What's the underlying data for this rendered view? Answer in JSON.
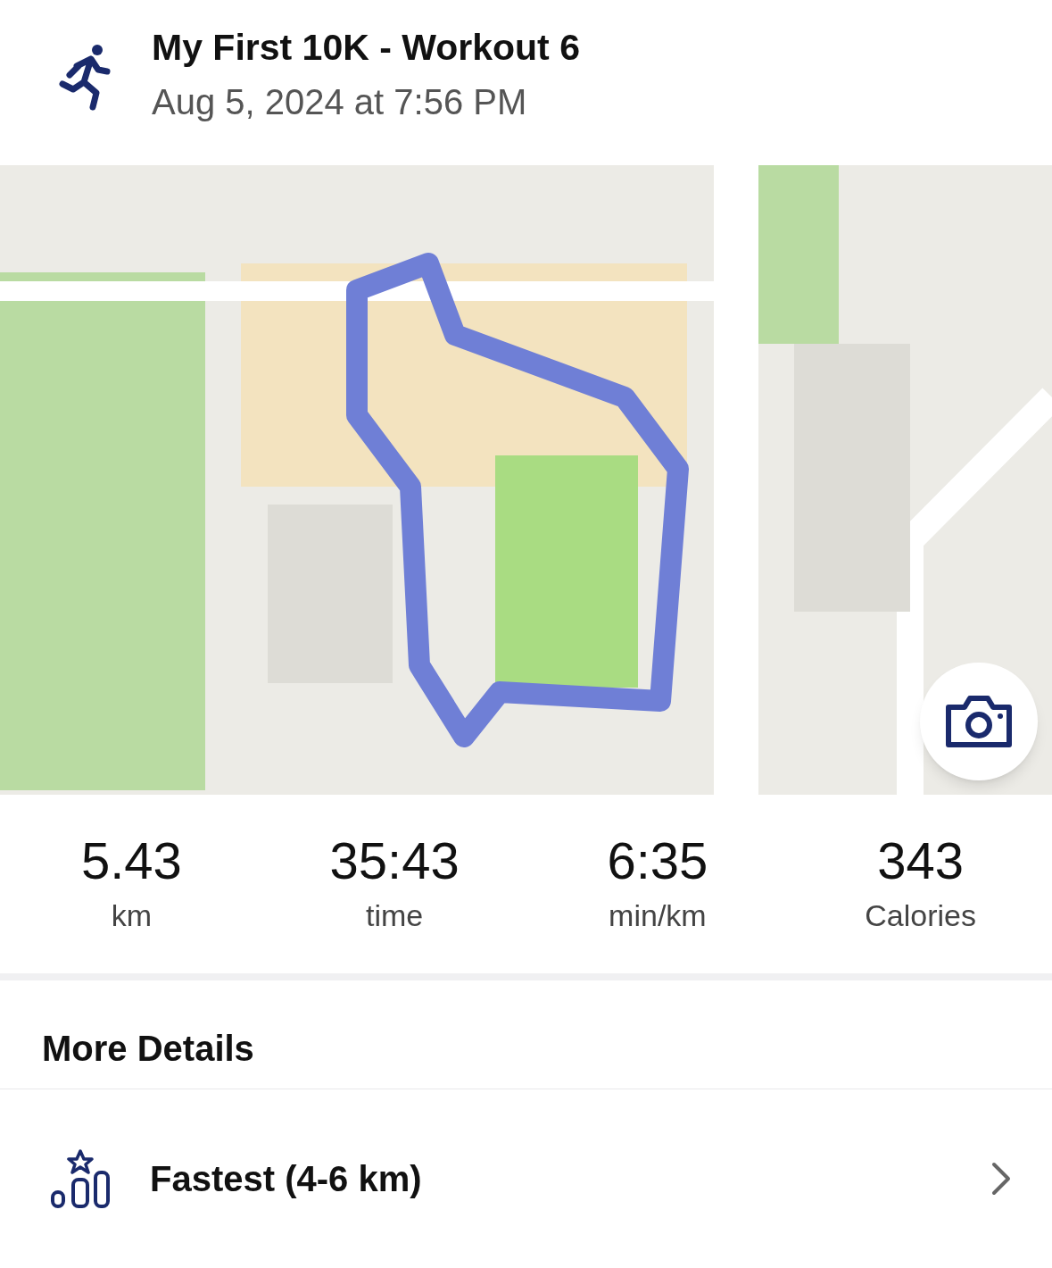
{
  "header": {
    "title": "My First 10K - Workout 6",
    "date": "Aug 5, 2024 at 7:56 PM"
  },
  "stats": [
    {
      "value": "5.43",
      "unit": "km"
    },
    {
      "value": "35:43",
      "unit": "time"
    },
    {
      "value": "6:35",
      "unit": "min/km"
    },
    {
      "value": "343",
      "unit": "Calories"
    }
  ],
  "more_details": {
    "heading": "More Details",
    "items": [
      {
        "label": "Fastest (4-6 km)"
      }
    ]
  }
}
